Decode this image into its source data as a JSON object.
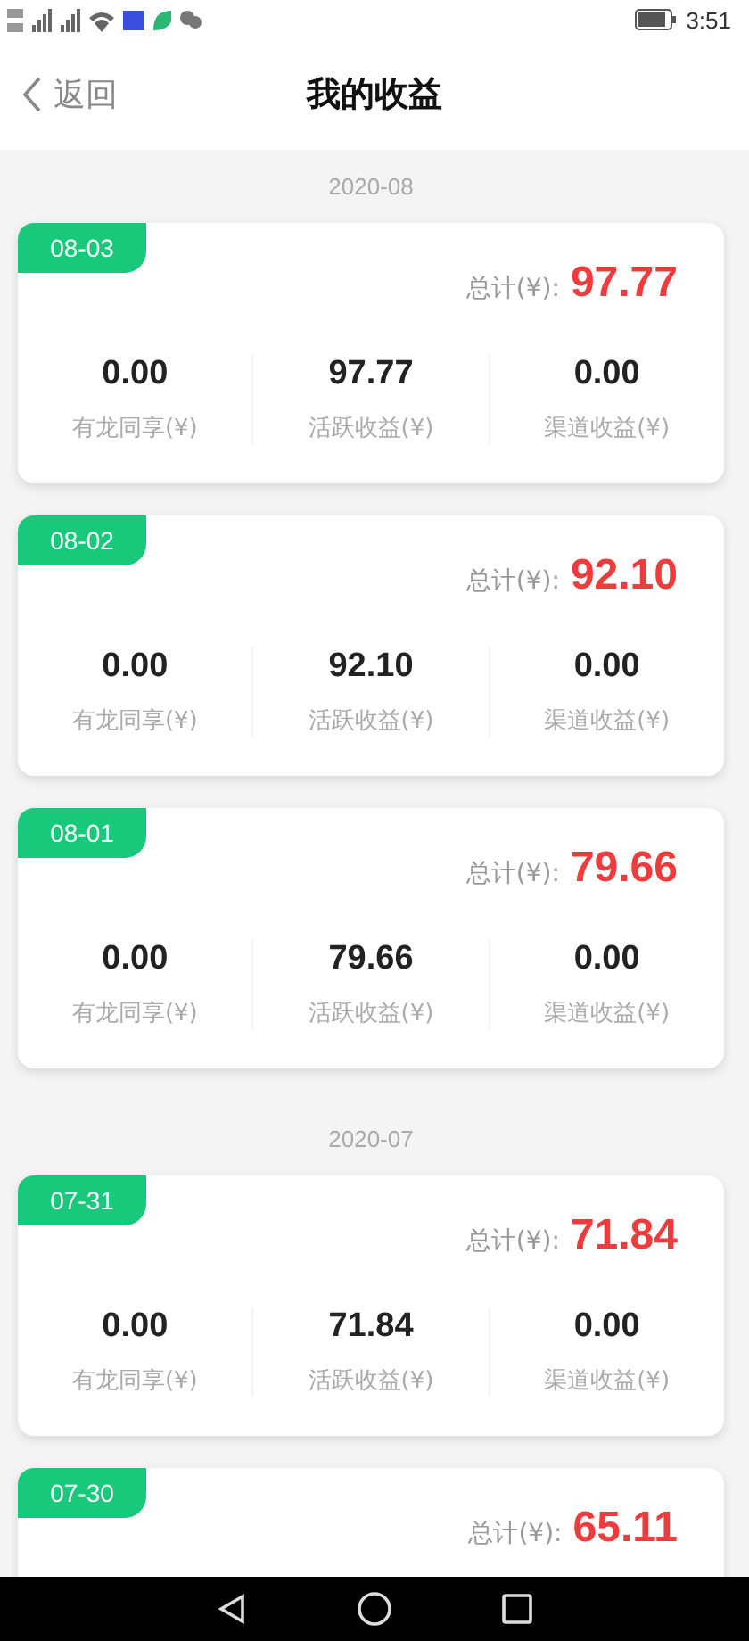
{
  "status_bar": {
    "time": "3:51"
  },
  "header": {
    "back": "返回",
    "title": "我的收益"
  },
  "groups": [
    {
      "month": "2020-08",
      "days": [
        {
          "date": "08-03",
          "total_label": "总计(¥):",
          "total": "97.77",
          "items": [
            {
              "value": "0.00",
              "label": "有龙同享(¥)"
            },
            {
              "value": "97.77",
              "label": "活跃收益(¥)"
            },
            {
              "value": "0.00",
              "label": "渠道收益(¥)"
            }
          ]
        },
        {
          "date": "08-02",
          "total_label": "总计(¥):",
          "total": "92.10",
          "items": [
            {
              "value": "0.00",
              "label": "有龙同享(¥)"
            },
            {
              "value": "92.10",
              "label": "活跃收益(¥)"
            },
            {
              "value": "0.00",
              "label": "渠道收益(¥)"
            }
          ]
        },
        {
          "date": "08-01",
          "total_label": "总计(¥):",
          "total": "79.66",
          "items": [
            {
              "value": "0.00",
              "label": "有龙同享(¥)"
            },
            {
              "value": "79.66",
              "label": "活跃收益(¥)"
            },
            {
              "value": "0.00",
              "label": "渠道收益(¥)"
            }
          ]
        }
      ]
    },
    {
      "month": "2020-07",
      "days": [
        {
          "date": "07-31",
          "total_label": "总计(¥):",
          "total": "71.84",
          "items": [
            {
              "value": "0.00",
              "label": "有龙同享(¥)"
            },
            {
              "value": "71.84",
              "label": "活跃收益(¥)"
            },
            {
              "value": "0.00",
              "label": "渠道收益(¥)"
            }
          ]
        },
        {
          "date": "07-30",
          "total_label": "总计(¥):",
          "total": "65.11"
        }
      ]
    }
  ]
}
